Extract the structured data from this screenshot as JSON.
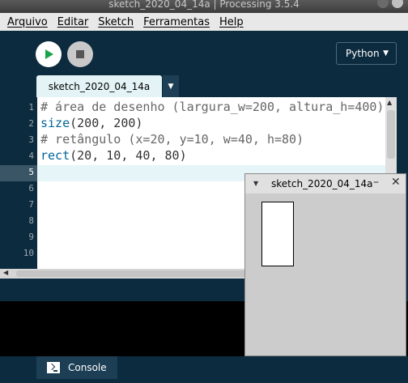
{
  "window": {
    "title": "sketch_2020_04_14a | Processing 3.5.4"
  },
  "menu": [
    "Arquivo",
    "Editar",
    "Sketch",
    "Ferramentas",
    "Help"
  ],
  "toolbar": {
    "mode": "Python",
    "run_icon": "play-icon",
    "stop_icon": "stop-icon"
  },
  "tabs": [
    {
      "label": "sketch_2020_04_14a"
    }
  ],
  "editor": {
    "line_numbers": [
      "1",
      "2",
      "3",
      "4",
      "5",
      "6",
      "7",
      "8",
      "9",
      "10"
    ],
    "current_line": 5,
    "lines": [
      {
        "parts": [
          {
            "text": "# área de desenho (largura_w=200, altura_h=400)",
            "kind": "comment"
          }
        ]
      },
      {
        "parts": [
          {
            "text": "size",
            "kind": "fn"
          },
          {
            "text": "(200, 200)",
            "kind": "plain"
          }
        ]
      },
      {
        "parts": [
          {
            "text": "# retângulo (x=20, y=10, w=40, h=80)",
            "kind": "comment"
          }
        ]
      },
      {
        "parts": [
          {
            "text": "rect",
            "kind": "fn"
          },
          {
            "text": "(20, 10, 40, 80)",
            "kind": "plain"
          }
        ]
      }
    ]
  },
  "console": {
    "label": "Console"
  },
  "sketch_window": {
    "title": "sketch_2020_04_14a",
    "min_glyph": "–",
    "close_glyph": "✕"
  },
  "colors": {
    "bg": "#0d2b3e",
    "comment": "#666666",
    "function": "#006699",
    "tab": "#e4f4f6"
  }
}
